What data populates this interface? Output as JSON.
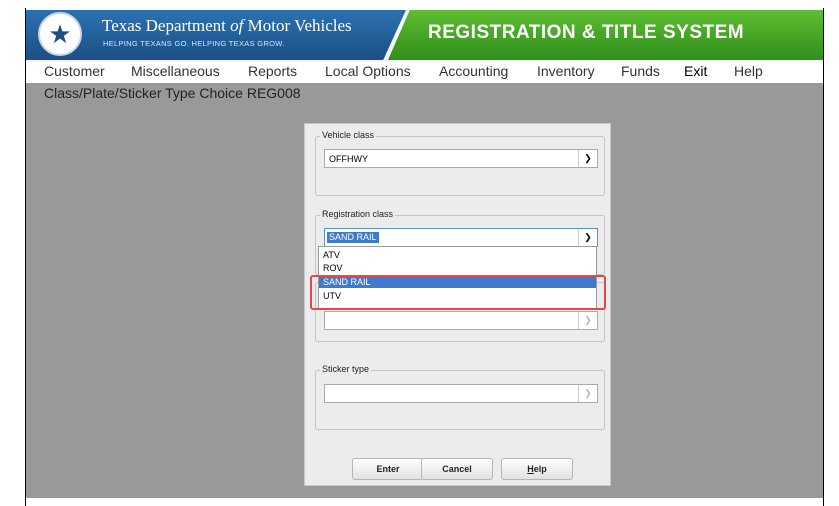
{
  "header": {
    "agency_pre": "Texas Department ",
    "agency_of": "of",
    "agency_post": " Motor Vehicles",
    "slogan": "HELPING TEXANS GO. HELPING TEXAS GROW.",
    "system_title": "REGISTRATION & TITLE SYSTEM",
    "logo_icon": "star-icon"
  },
  "menu": {
    "items": [
      "Customer",
      "Miscellaneous",
      "Reports",
      "Local Options",
      "Accounting",
      "Inventory",
      "Funds",
      "Exit",
      "Help"
    ]
  },
  "page": {
    "title": "Class/Plate/Sticker Type Choice REG008"
  },
  "form": {
    "vehicle_class": {
      "label": "Vehicle class",
      "value": "OFFHWY"
    },
    "registration_class": {
      "label": "Registration class",
      "value": "SAND RAIL",
      "options": [
        "ATV",
        "ROV",
        "SAND RAIL",
        "UTV"
      ],
      "selected": "SAND RAIL"
    },
    "plate_type": {
      "label": "",
      "value": ""
    },
    "sticker_type": {
      "label": "Sticker type",
      "value": ""
    }
  },
  "buttons": {
    "enter": "Enter",
    "cancel": "Cancel",
    "help_letter": "H",
    "help_rest": "elp"
  },
  "colors": {
    "header_blue": "#1b4f86",
    "header_green": "#3f9f22",
    "selection_blue": "#3d7bd0",
    "highlight_red": "#e04a4a",
    "workspace_gray": "#999999"
  }
}
